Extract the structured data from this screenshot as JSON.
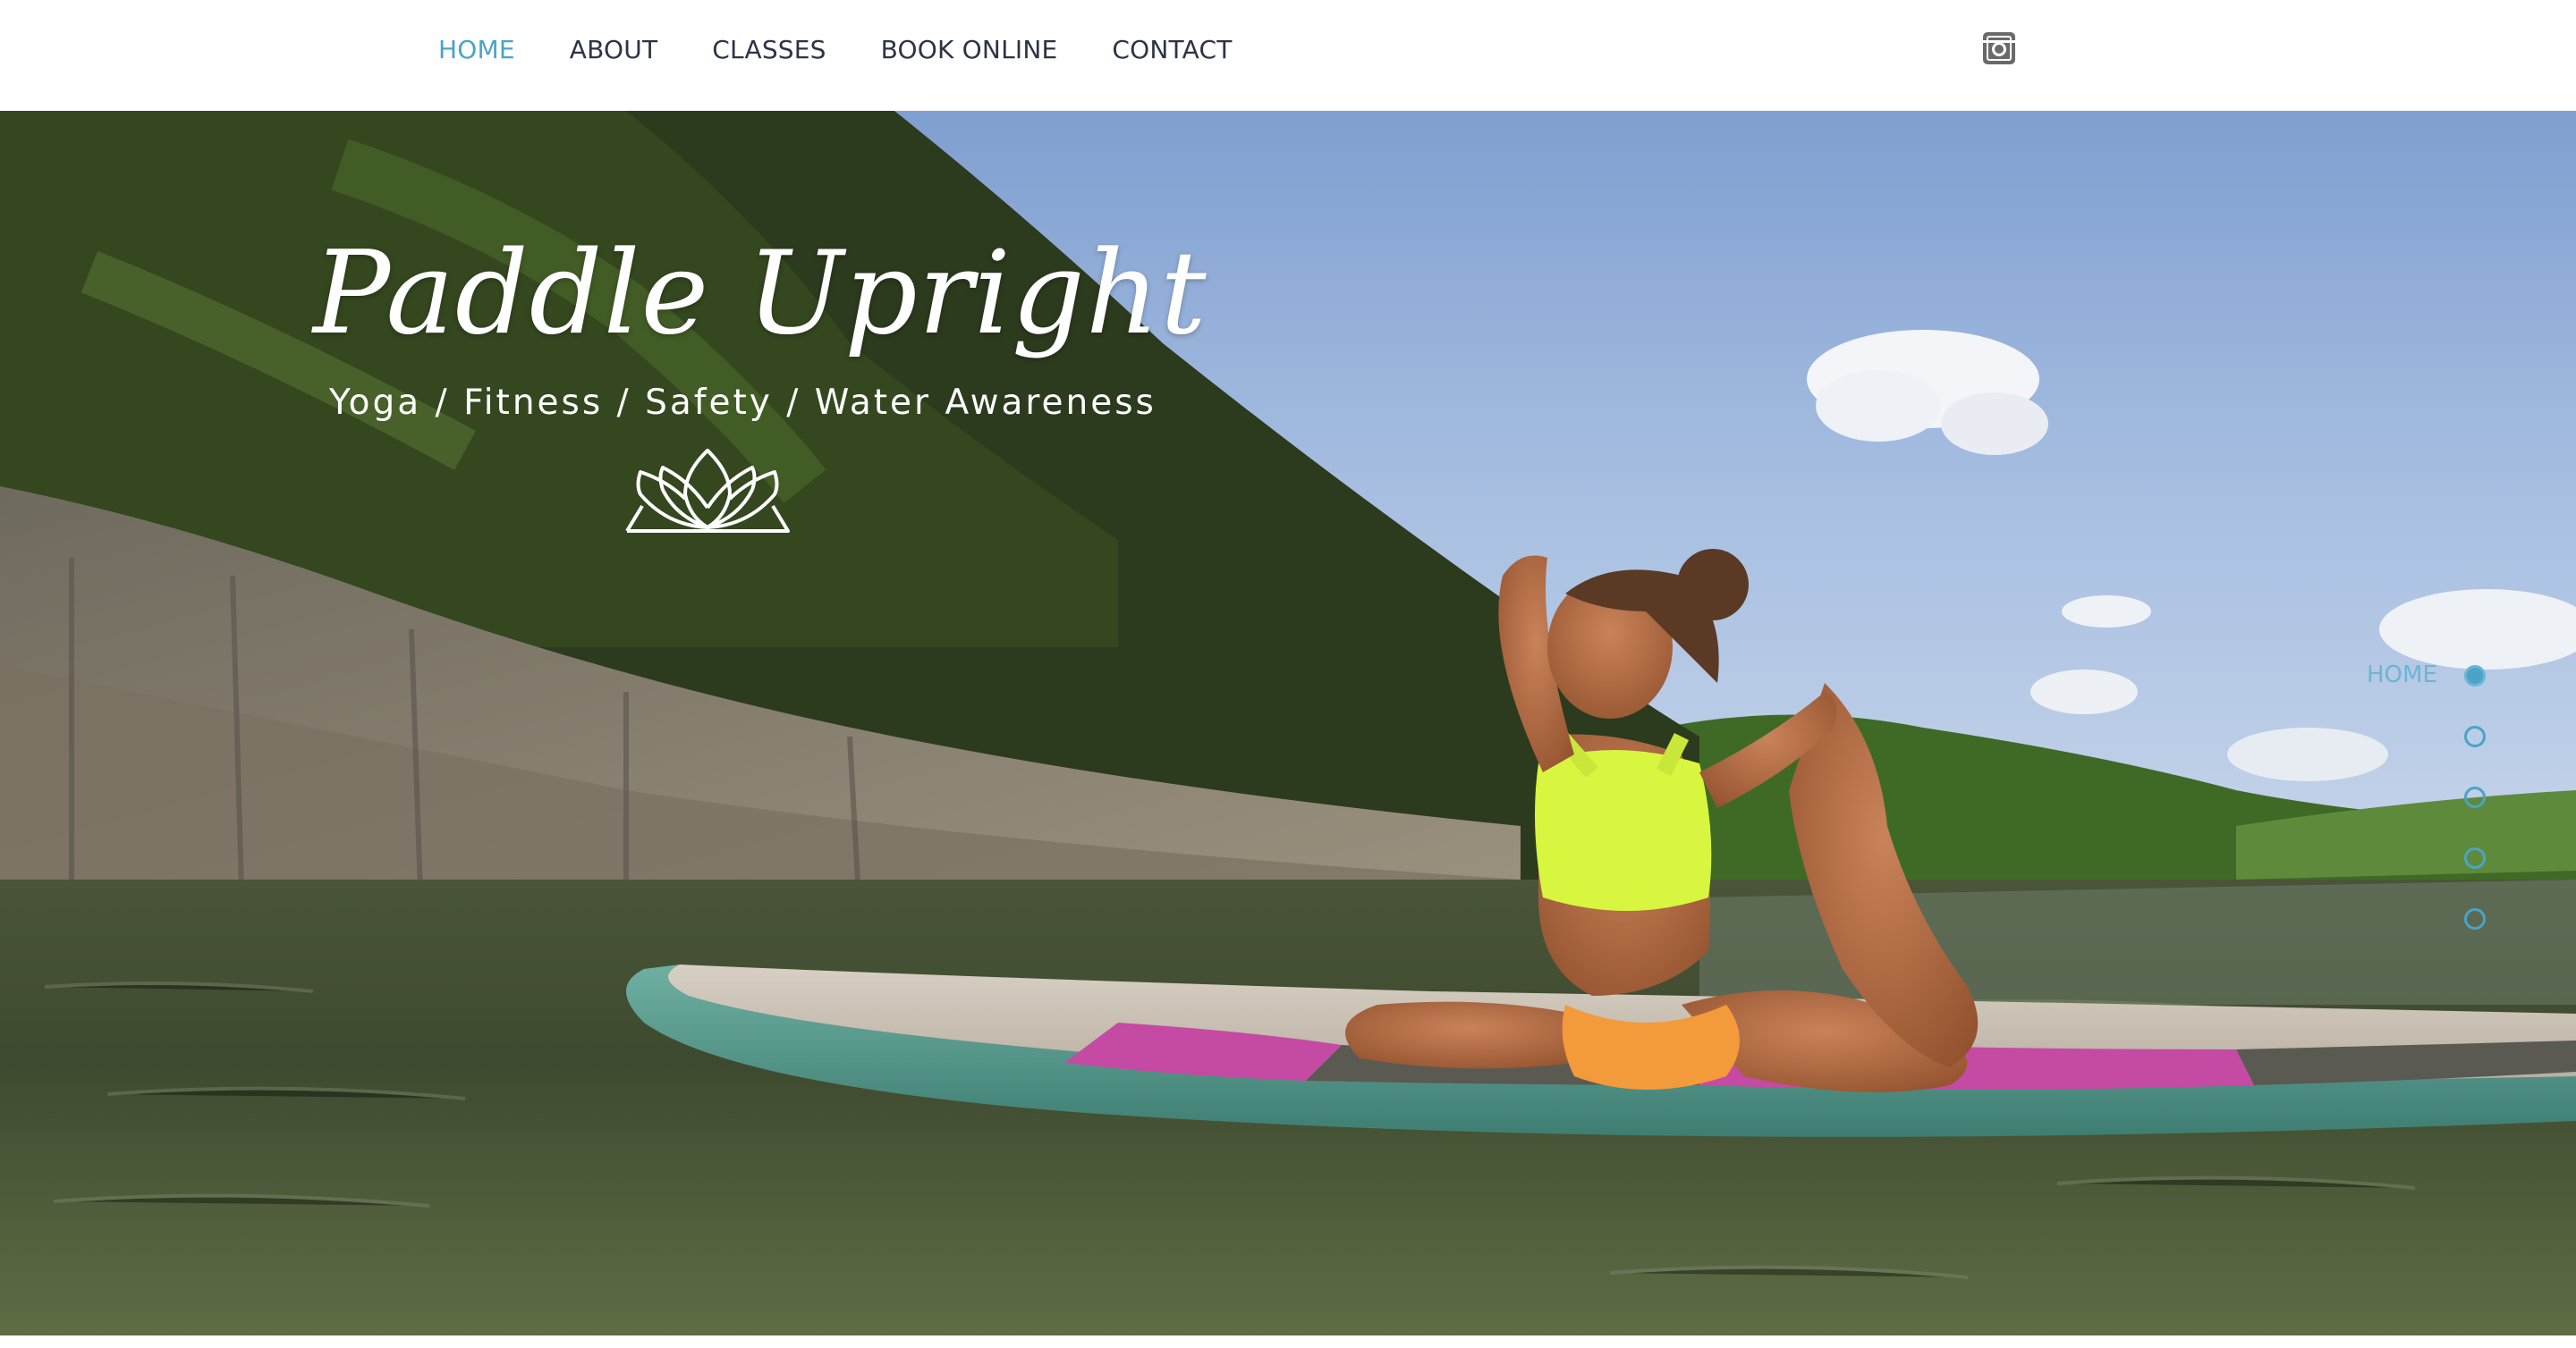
{
  "nav": {
    "items": [
      {
        "label": "HOME",
        "active": true
      },
      {
        "label": "ABOUT",
        "active": false
      },
      {
        "label": "CLASSES",
        "active": false
      },
      {
        "label": "BOOK ONLINE",
        "active": false
      },
      {
        "label": "CONTACT",
        "active": false
      }
    ],
    "social_icon": "instagram-icon"
  },
  "hero": {
    "title": "Paddle Upright",
    "subtitle": "Yoga / Fitness / Safety / Water Awareness",
    "logo_icon": "lotus-icon"
  },
  "anchor_menu": {
    "active_label": "HOME",
    "dots": [
      "home",
      "section-2",
      "section-3",
      "section-4",
      "section-5"
    ]
  },
  "colors": {
    "accent": "#4ba3c7",
    "nav_text": "#2c3446",
    "hero_text": "#ffffff"
  }
}
